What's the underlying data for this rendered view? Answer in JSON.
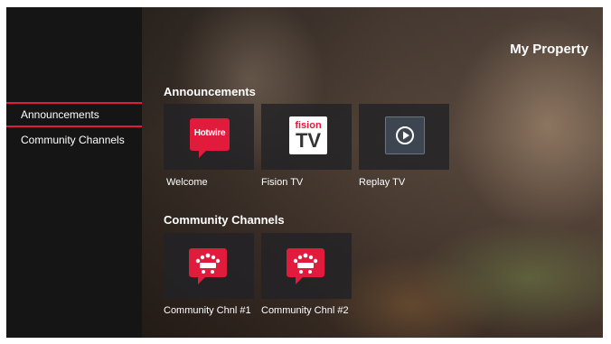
{
  "app": {
    "property_title": "My Property",
    "accent": "#e11b3c"
  },
  "sidebar": {
    "items": [
      {
        "label": "Announcements",
        "active": true
      },
      {
        "label": "Community Channels",
        "active": false
      }
    ]
  },
  "sections": [
    {
      "title": "Announcements",
      "tiles": [
        {
          "label": "Welcome",
          "icon": "hotwire-logo-icon",
          "logo_text": "Hotwire"
        },
        {
          "label": "Fision TV",
          "icon": "fision-tv-icon",
          "logo_text_top": "fision",
          "logo_text_bottom": "TV"
        },
        {
          "label": "Replay TV",
          "icon": "replay-play-icon"
        }
      ]
    },
    {
      "title": "Community Channels",
      "tiles": [
        {
          "label": "Community Chnl #1",
          "icon": "community-meeting-icon"
        },
        {
          "label": "Community Chnl #2",
          "icon": "community-meeting-icon"
        }
      ]
    }
  ]
}
